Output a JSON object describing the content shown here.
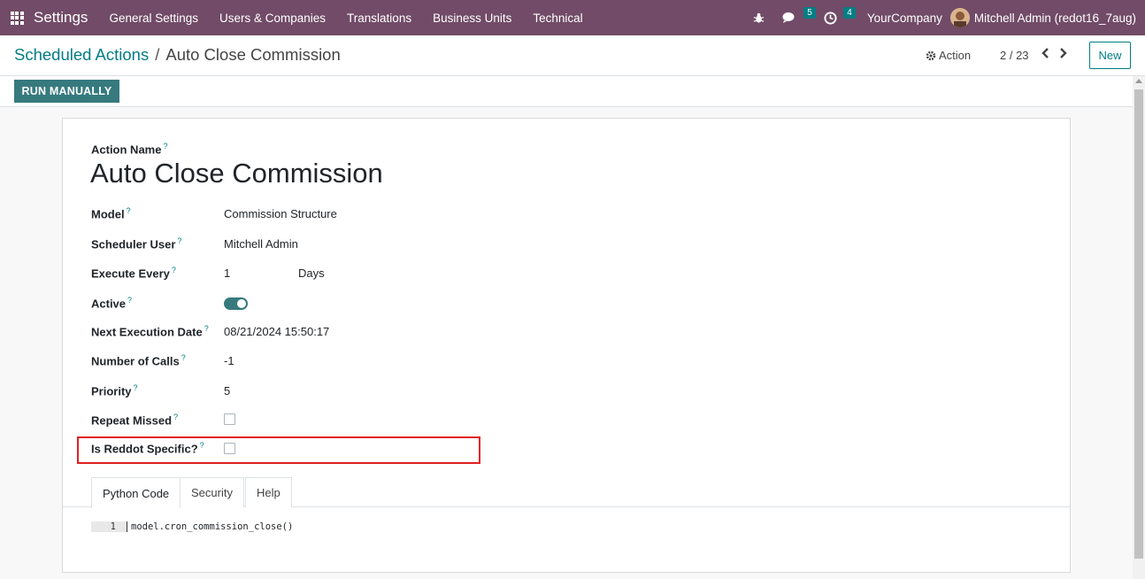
{
  "navbar": {
    "brand": "Settings",
    "menu": [
      "General Settings",
      "Users & Companies",
      "Translations",
      "Business Units",
      "Technical"
    ],
    "messages_count": "5",
    "activities_count": "4",
    "company": "YourCompany",
    "user": "Mitchell Admin (redot16_7aug)"
  },
  "breadcrumb": {
    "parent": "Scheduled Actions",
    "separator": "/",
    "current": "Auto Close Commission"
  },
  "control": {
    "action_label": "Action",
    "pager": "2 / 23",
    "new_label": "New"
  },
  "statusbar": {
    "run_label": "RUN MANUALLY"
  },
  "form": {
    "name_label": "Action Name",
    "name_value": "Auto Close Commission",
    "help_mark": "?",
    "fields": {
      "model": {
        "label": "Model",
        "value": "Commission Structure"
      },
      "user": {
        "label": "Scheduler User",
        "value": "Mitchell Admin"
      },
      "interval": {
        "label": "Execute Every",
        "value": "1",
        "unit": "Days"
      },
      "active": {
        "label": "Active",
        "value": true
      },
      "nextcall": {
        "label": "Next Execution Date",
        "value": "08/21/2024 15:50:17"
      },
      "numbercall": {
        "label": "Number of Calls",
        "value": "-1"
      },
      "priority": {
        "label": "Priority",
        "value": "5"
      },
      "doall": {
        "label": "Repeat Missed",
        "value": false
      },
      "reddot": {
        "label": "Is Reddot Specific?",
        "value": false
      }
    },
    "tabs": [
      "Python Code",
      "Security",
      "Help"
    ],
    "active_tab": "Python Code",
    "code": {
      "line_no": "1",
      "text": "model.cron_commission_close()"
    }
  },
  "colors": {
    "navbar": "#714b67",
    "primary": "#017e84",
    "highlight": "#e02020"
  }
}
